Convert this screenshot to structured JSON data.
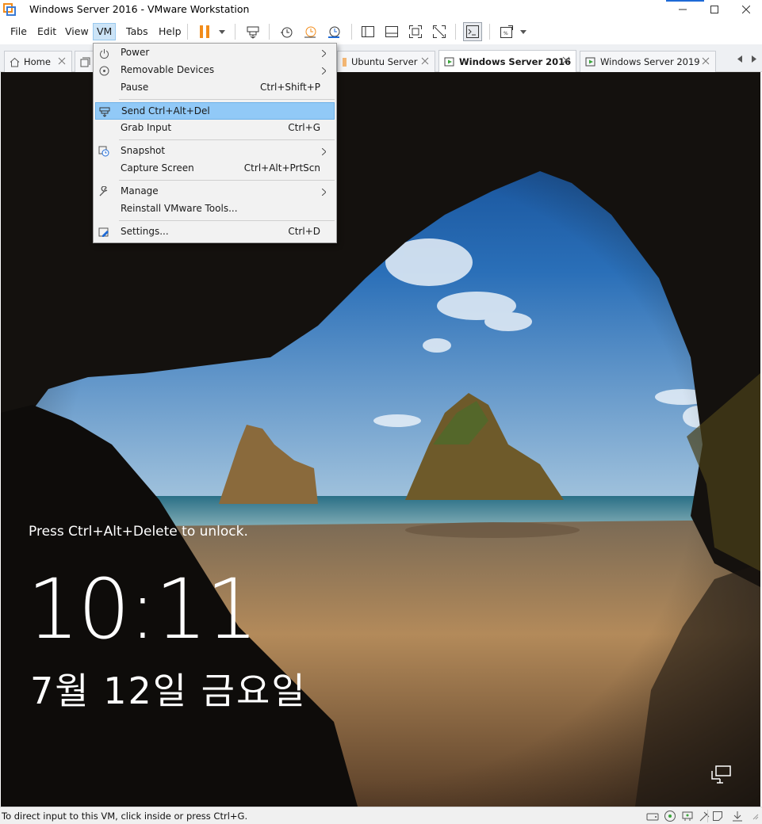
{
  "window": {
    "title": "Windows Server 2016 - VMware Workstation",
    "controls": [
      "minimize",
      "maximize",
      "close"
    ]
  },
  "menubar": {
    "items": [
      {
        "label": "File"
      },
      {
        "label": "Edit"
      },
      {
        "label": "View"
      },
      {
        "label": "VM",
        "active": true
      },
      {
        "label": "Tabs"
      },
      {
        "label": "Help"
      }
    ]
  },
  "toolbar": {
    "buttons": [
      "pause-icon",
      "send-keys-icon",
      "snapshot-icon",
      "revert-snapshot-icon",
      "snapshot-manager-icon",
      "library-view-icon",
      "thumbnail-view-icon",
      "fullscreen-icon",
      "unity-icon",
      "console-icon",
      "stretch-view-icon"
    ],
    "accent_color": "#f28c1a"
  },
  "tabs": [
    {
      "label": "Home",
      "icon": "home-icon",
      "selected": false
    },
    {
      "label": "",
      "icon": "library-icon",
      "selected": false
    },
    {
      "label": "Ubuntu Server",
      "icon": "vm-icon",
      "selected": false
    },
    {
      "label": "Windows Server 2016",
      "icon": "vm-running-icon",
      "selected": true
    },
    {
      "label": "Windows Server 2019",
      "icon": "vm-running-icon",
      "selected": false
    }
  ],
  "vm_menu": {
    "items": [
      {
        "label": "Power",
        "icon": "power-icon",
        "shortcut": "",
        "submenu": true
      },
      {
        "label": "Removable Devices",
        "icon": "removable-devices-icon",
        "shortcut": "",
        "submenu": true
      },
      {
        "label": "Pause",
        "icon": "",
        "shortcut": "Ctrl+Shift+P",
        "submenu": false
      },
      {
        "label": "Send Ctrl+Alt+Del",
        "icon": "send-keys-icon",
        "shortcut": "",
        "submenu": false,
        "highlighted": true
      },
      {
        "label": "Grab Input",
        "icon": "",
        "shortcut": "Ctrl+G",
        "submenu": false
      },
      {
        "label": "Snapshot",
        "icon": "snapshot-icon",
        "shortcut": "",
        "submenu": true
      },
      {
        "label": "Capture Screen",
        "icon": "",
        "shortcut": "Ctrl+Alt+PrtScn",
        "submenu": false
      },
      {
        "label": "Manage",
        "icon": "wrench-icon",
        "shortcut": "",
        "submenu": true
      },
      {
        "label": "Reinstall VMware Tools...",
        "icon": "",
        "shortcut": "",
        "submenu": false
      },
      {
        "label": "Settings...",
        "icon": "settings-icon",
        "shortcut": "Ctrl+D",
        "submenu": false
      }
    ]
  },
  "lock_screen": {
    "message": "Press Ctrl+Alt+Delete to unlock.",
    "time": "10:11",
    "date": "7월 12일 금요일"
  },
  "statusbar": {
    "text": "To direct input to this VM, click inside or press Ctrl+G.",
    "icons": [
      "hard-disk-icon",
      "cd-dvd-icon",
      "network-adapter-icon",
      "usb-icon",
      "message-icon",
      "download-icon"
    ]
  }
}
